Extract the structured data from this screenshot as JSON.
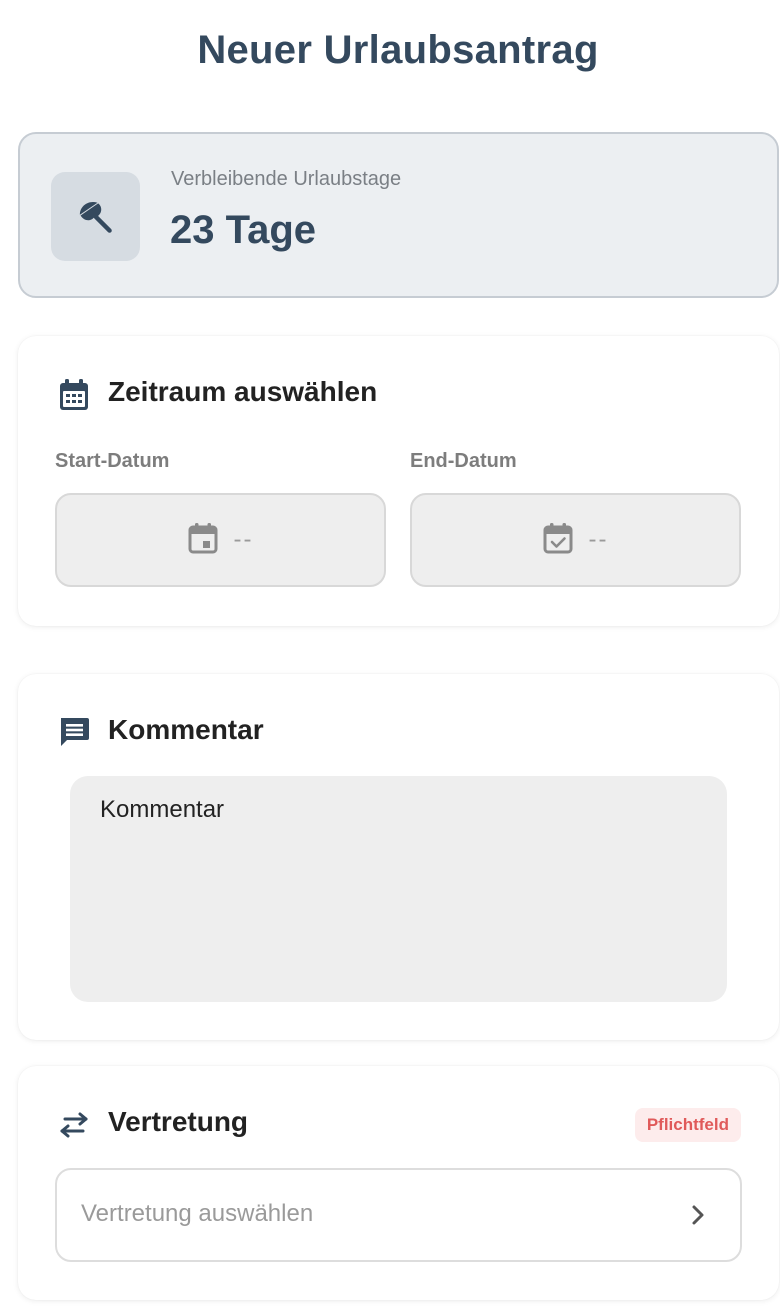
{
  "page": {
    "title": "Neuer Urlaubsantrag"
  },
  "balance": {
    "label": "Verbleibende Urlaubstage",
    "value": "23 Tage",
    "icon": "beach-umbrella-icon"
  },
  "period": {
    "title": "Zeitraum auswählen",
    "icon": "calendar-icon",
    "start": {
      "label": "Start-Datum",
      "value": "--",
      "icon": "calendar-event-icon"
    },
    "end": {
      "label": "End-Datum",
      "value": "--",
      "icon": "calendar-check-icon"
    }
  },
  "comment": {
    "title": "Kommentar",
    "icon": "comment-icon",
    "placeholder": "Kommentar"
  },
  "substitute": {
    "title": "Vertretung",
    "icon": "swap-icon",
    "badge": "Pflichtfeld",
    "placeholder": "Vertretung auswählen"
  },
  "colors": {
    "primary": "#34495e",
    "badge_text": "#e05a5a",
    "badge_bg": "#fdecec"
  }
}
